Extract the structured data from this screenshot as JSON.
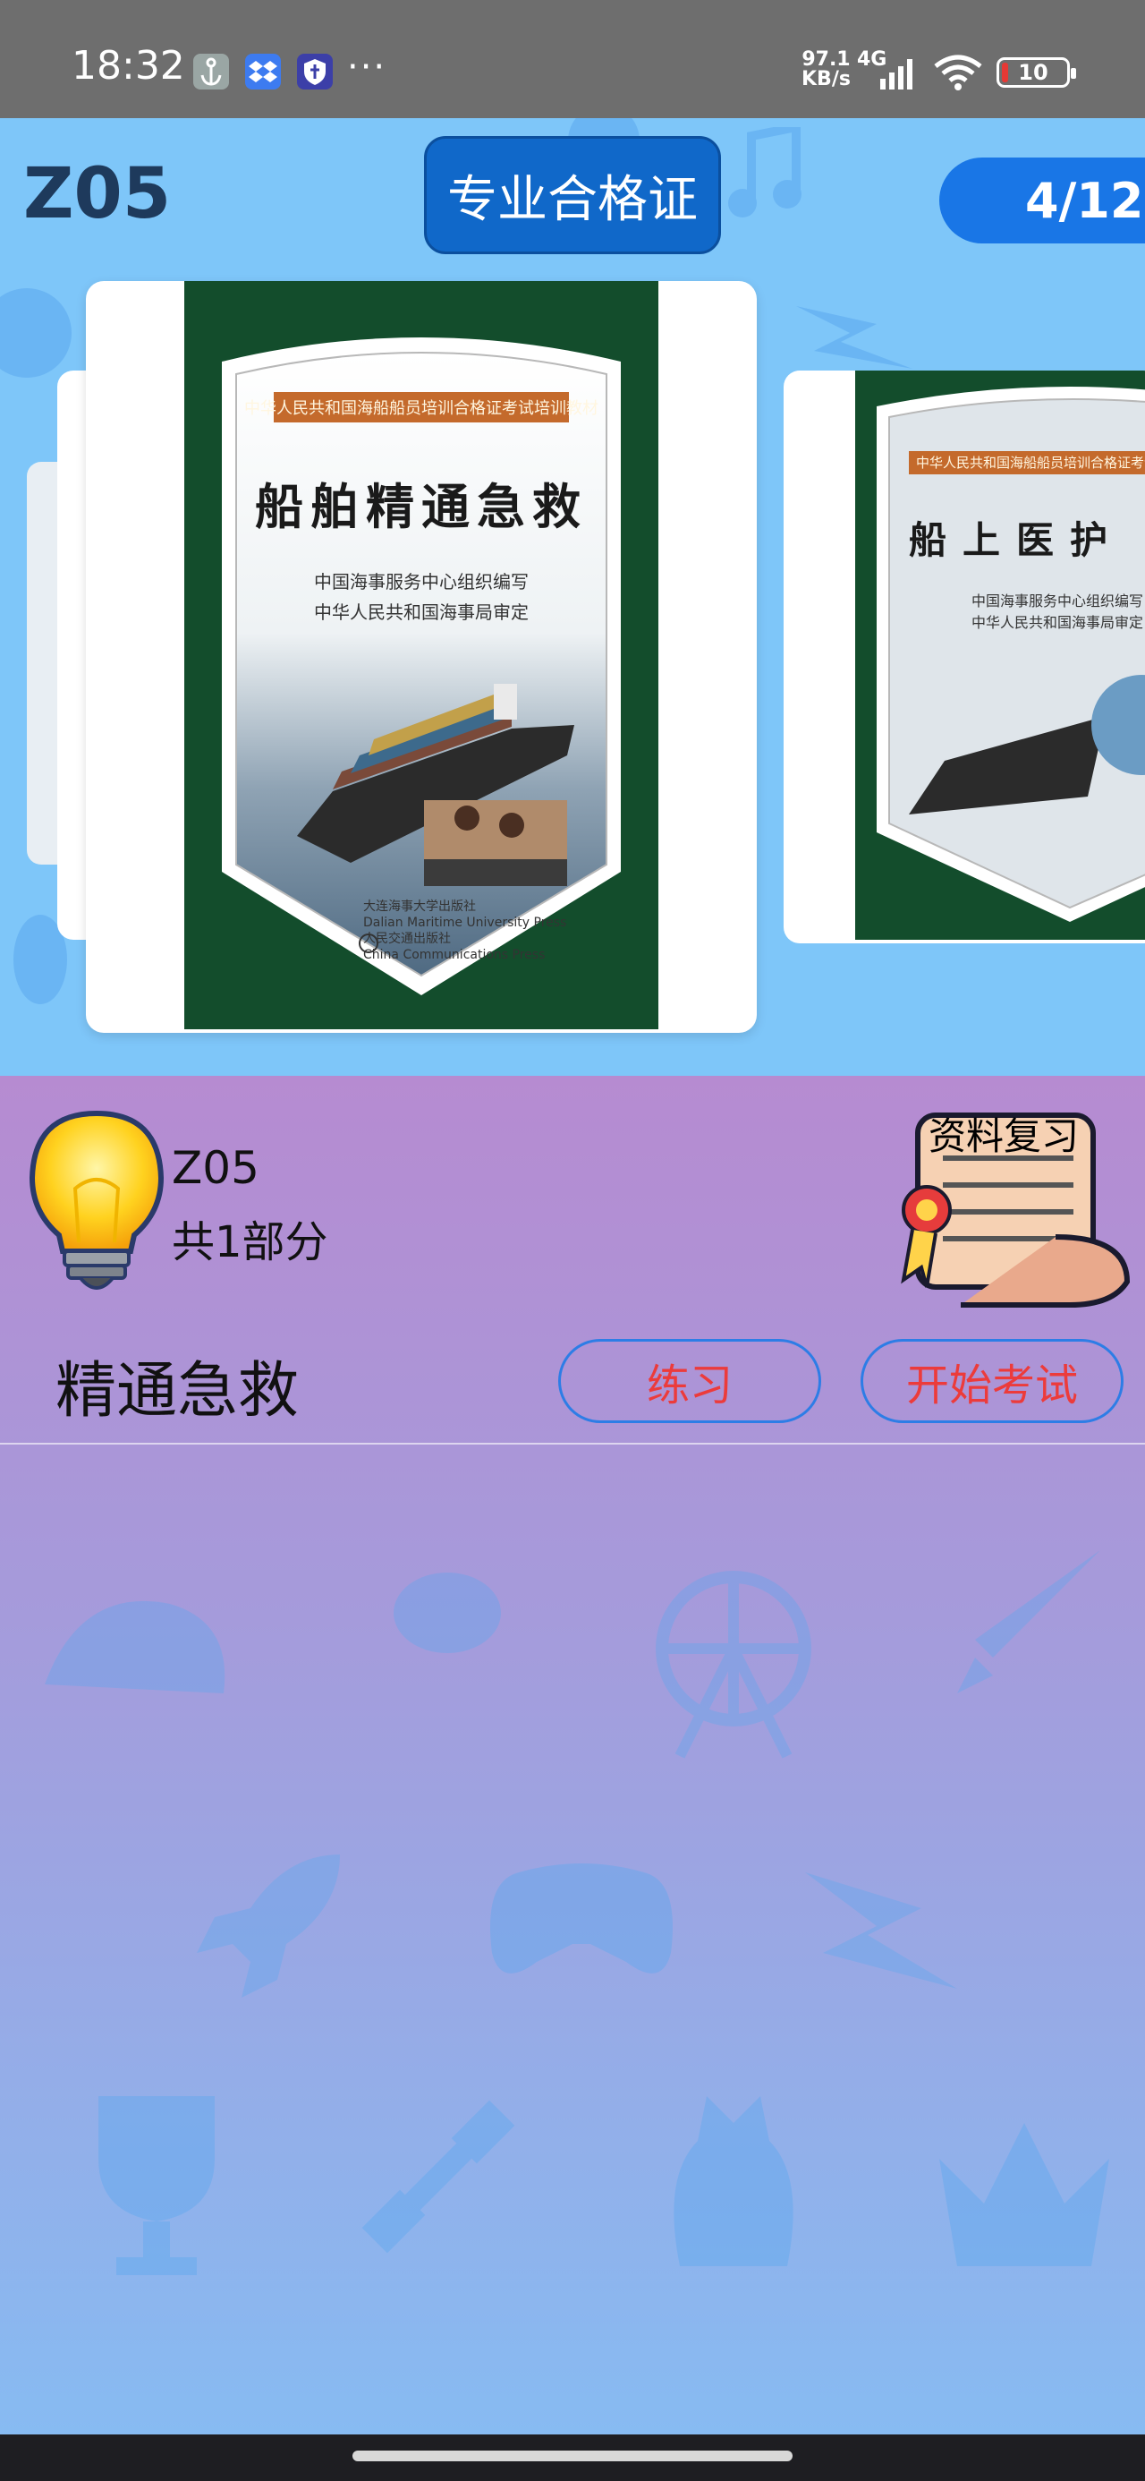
{
  "status_bar": {
    "time": "18:32",
    "dots": "···",
    "net_speed_value": "97.1",
    "net_speed_unit": "KB/s",
    "net_type": "4G",
    "battery_level": "10",
    "battery_fraction": 0.1,
    "icons": [
      "anchor-app-icon",
      "dropbox-app-icon",
      "shield-app-icon",
      "signal-icon",
      "wifi-icon",
      "battery-icon"
    ]
  },
  "header": {
    "code": "Z05",
    "cert_button": "专业合格证",
    "page_indicator": "4/12"
  },
  "carousel": {
    "current_book": {
      "series": "中华人民共和国海船船员培训合格证考试培训教材",
      "title": "船舶精通急救",
      "author_line1": "中国海事服务中心组织编写",
      "author_line2": "中华人民共和国海事局审定",
      "publisher_line1": "大连海事大学出版社",
      "publisher_line2": "Dalian Maritime University Press",
      "publisher_line3": "人民交通出版社",
      "publisher_line4": "China Communications Press"
    },
    "next_book": {
      "series": "中华人民共和国海船船员培训合格证考试培训教材",
      "title": "船上医护",
      "author_line1": "中国海事服务中心组织编写",
      "author_line2": "中华人民共和国海事局审定"
    }
  },
  "section": {
    "code": "Z05",
    "parts": "共1部分",
    "review_label": "资料复习",
    "item_title": "精通急救",
    "practice_button": "练习",
    "exam_button": "开始考试"
  },
  "colors": {
    "top_bg": "#7ec6f9",
    "cert_button": "#1068c9",
    "page_indicator": "#1976e6",
    "panel_top": "#b68bd1",
    "panel_bottom": "#87bbf2",
    "button_text": "#ec3b3b",
    "button_border": "#2d7de6"
  }
}
